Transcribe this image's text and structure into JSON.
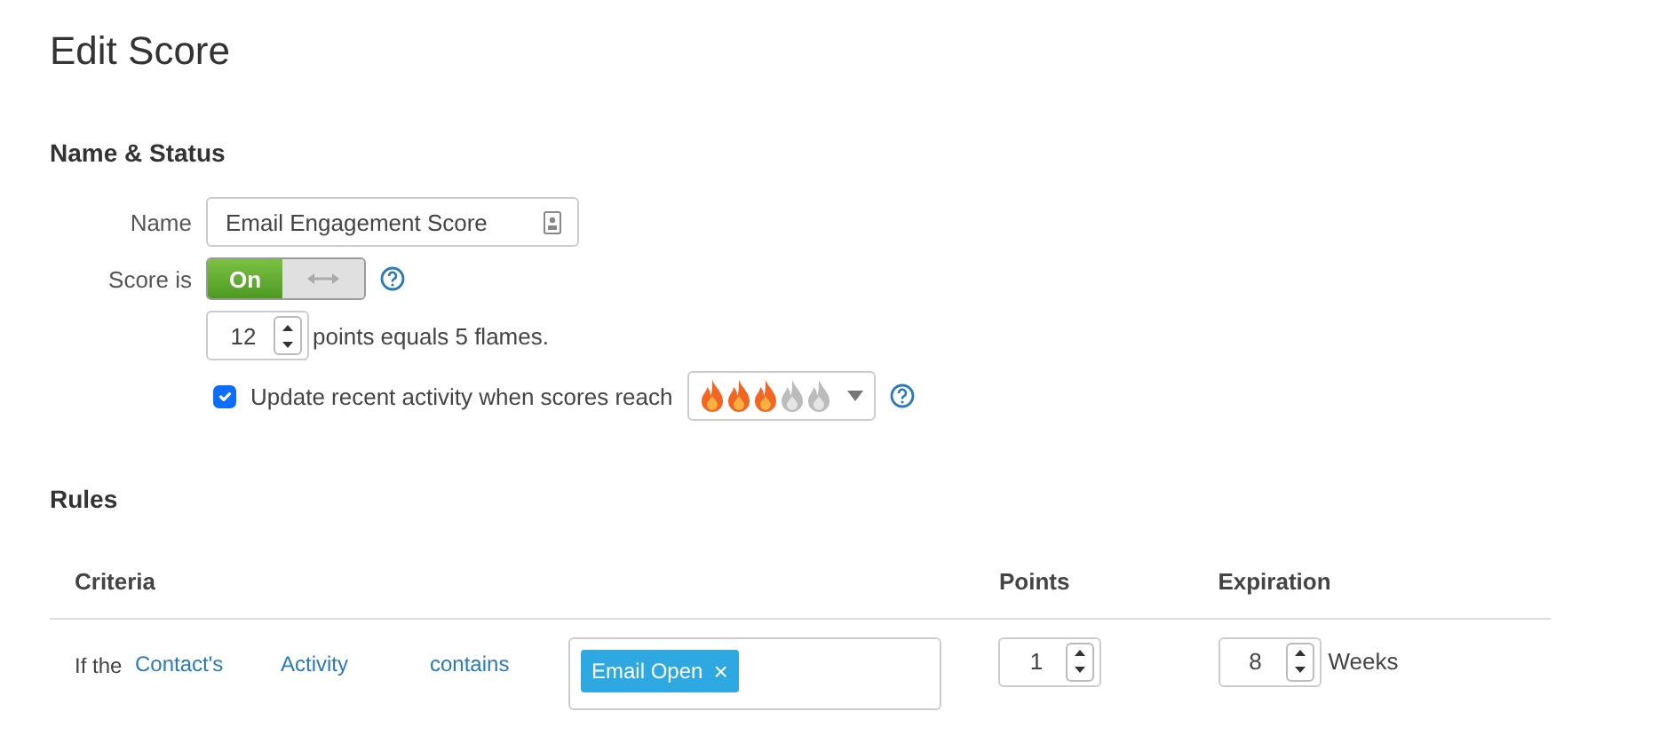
{
  "page": {
    "title": "Edit Score"
  },
  "name_status": {
    "heading": "Name & Status",
    "name": {
      "label": "Name",
      "value": "Email Engagement Score"
    },
    "score": {
      "label": "Score is",
      "toggle_label": "On",
      "on": true
    },
    "points": {
      "value": "12",
      "suffix": "points equals 5 flames."
    },
    "update": {
      "label": "Update recent activity when scores reach",
      "checked": true,
      "stars": 3
    }
  },
  "rules": {
    "heading": "Rules",
    "columns": [
      "Criteria",
      "Points",
      "Expiration"
    ],
    "rows": [
      {
        "prefix": "If the",
        "subject": "Contact's",
        "field": "Activity",
        "operator": "contains",
        "tags": [
          {
            "label": "Email Open",
            "remove": "×"
          }
        ],
        "points": "1",
        "expiration": "8",
        "unit": "Weeks"
      }
    ]
  }
}
